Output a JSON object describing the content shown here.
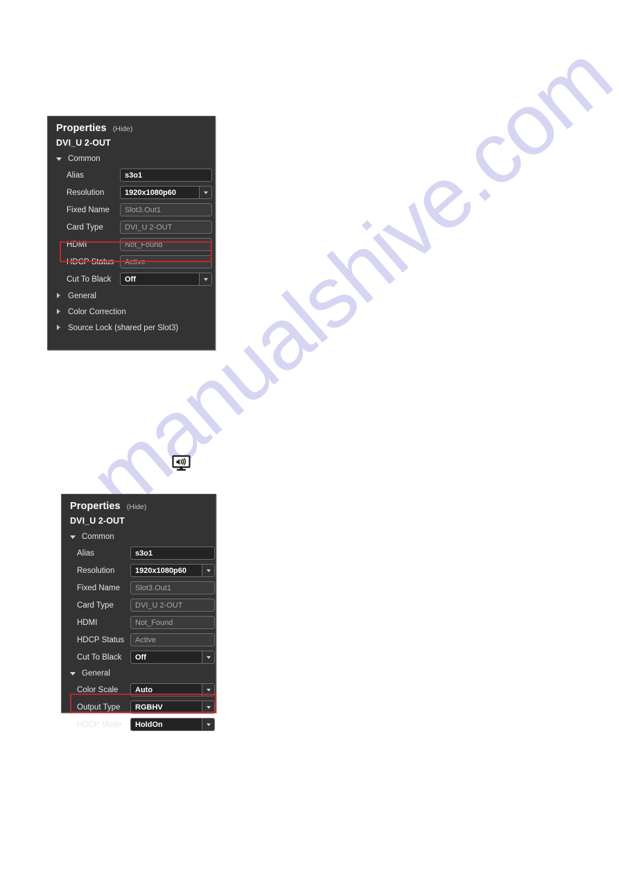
{
  "watermark": {
    "text": "manualshive.com",
    "color": "#c9c8ee"
  },
  "icons": {
    "display_speaker": "display-speaker-icon",
    "chevron_down": "chevron-down-icon",
    "triangle_expanded": "triangle-down-icon",
    "triangle_collapsed": "triangle-right-icon"
  },
  "colors": {
    "panel_bg": "#333333",
    "panel_border": "#5a5a5a",
    "field_editable_bg": "#232323",
    "field_readonly_bg": "#3b3b3b",
    "highlight_red": "#c0272d",
    "text_primary": "#ffffff",
    "text_secondary": "#a8a8a8"
  },
  "panel1": {
    "title": "Properties",
    "hide_label": "(Hide)",
    "subtitle": "DVI_U 2-OUT",
    "sections": [
      {
        "label": "Common",
        "expanded": true,
        "rows": [
          {
            "label": "Alias",
            "value": "s3o1",
            "kind": "editable"
          },
          {
            "label": "Resolution",
            "value": "1920x1080p60",
            "kind": "dropdown"
          },
          {
            "label": "Fixed Name",
            "value": "Slot3.Out1",
            "kind": "readonly"
          },
          {
            "label": "Card Type",
            "value": "DVI_U 2-OUT",
            "kind": "readonly"
          },
          {
            "label": "HDMI",
            "value": "Not_Found",
            "kind": "readonly",
            "highlighted": true
          },
          {
            "label": "HDCP Status",
            "value": "Active",
            "kind": "readonly"
          },
          {
            "label": "Cut To Black",
            "value": "Off",
            "kind": "dropdown"
          }
        ]
      },
      {
        "label": "General",
        "expanded": false,
        "rows": []
      },
      {
        "label": "Color Correction",
        "expanded": false,
        "rows": []
      },
      {
        "label": "Source Lock (shared per Slot3)",
        "expanded": false,
        "rows": []
      }
    ]
  },
  "panel2": {
    "title": "Properties",
    "hide_label": "(Hide)",
    "subtitle": "DVI_U 2-OUT",
    "sections": [
      {
        "label": "Common",
        "expanded": true,
        "rows": [
          {
            "label": "Alias",
            "value": "s3o1",
            "kind": "editable"
          },
          {
            "label": "Resolution",
            "value": "1920x1080p60",
            "kind": "dropdown"
          },
          {
            "label": "Fixed Name",
            "value": "Slot3.Out1",
            "kind": "readonly"
          },
          {
            "label": "Card Type",
            "value": "DVI_U 2-OUT",
            "kind": "readonly"
          },
          {
            "label": "HDMI",
            "value": "Not_Found",
            "kind": "readonly"
          },
          {
            "label": "HDCP Status",
            "value": "Active",
            "kind": "readonly"
          },
          {
            "label": "Cut To Black",
            "value": "Off",
            "kind": "dropdown"
          }
        ]
      },
      {
        "label": "General",
        "expanded": true,
        "rows": [
          {
            "label": "Color Scale",
            "value": "Auto",
            "kind": "dropdown"
          },
          {
            "label": "Output Type",
            "value": "RGBHV",
            "kind": "dropdown"
          },
          {
            "label": "HDCP Mode",
            "value": "HoldOn",
            "kind": "dropdown",
            "highlighted": true
          }
        ]
      }
    ]
  }
}
